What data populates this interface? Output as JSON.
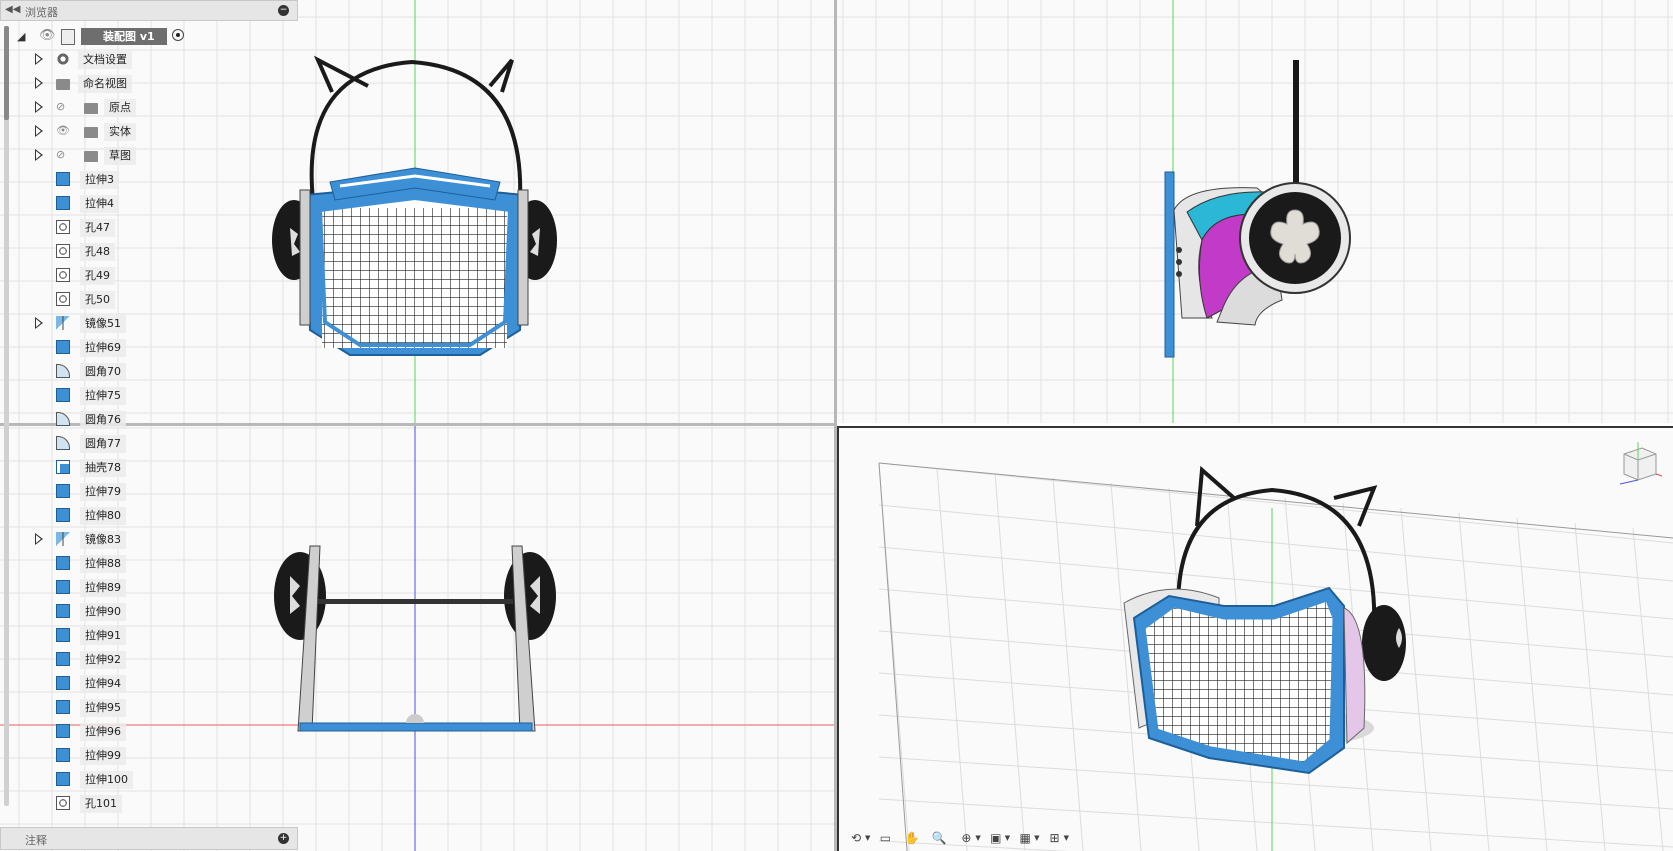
{
  "browser": {
    "title": "浏览器",
    "collapse_icon": "double-left-arrow",
    "root": {
      "label": "装配图 v1"
    },
    "items": [
      {
        "label": "文档设置",
        "icon": "gear-icon",
        "expandable": true,
        "visibility": false
      },
      {
        "label": "命名视图",
        "icon": "folder-icon",
        "expandable": true,
        "visibility": false
      },
      {
        "label": "原点",
        "icon": "folder-icon",
        "expandable": true,
        "visibility": "hidden"
      },
      {
        "label": "实体",
        "icon": "folder-icon",
        "expandable": true,
        "visibility": "visible"
      },
      {
        "label": "草图",
        "icon": "folder-icon",
        "expandable": true,
        "visibility": "hidden"
      },
      {
        "label": "拉伸3",
        "icon": "extrude-icon"
      },
      {
        "label": "拉伸4",
        "icon": "extrude-icon"
      },
      {
        "label": "孔47",
        "icon": "hole-icon"
      },
      {
        "label": "孔48",
        "icon": "hole-icon"
      },
      {
        "label": "孔49",
        "icon": "hole-icon"
      },
      {
        "label": "孔50",
        "icon": "hole-icon"
      },
      {
        "label": "镜像51",
        "icon": "mirror-icon",
        "expandable": true
      },
      {
        "label": "拉伸69",
        "icon": "extrude-icon"
      },
      {
        "label": "圆角70",
        "icon": "fillet-icon"
      },
      {
        "label": "拉伸75",
        "icon": "extrude-icon"
      },
      {
        "label": "圆角76",
        "icon": "fillet-icon"
      },
      {
        "label": "圆角77",
        "icon": "fillet-icon"
      },
      {
        "label": "抽壳78",
        "icon": "shell-icon"
      },
      {
        "label": "拉伸79",
        "icon": "extrude-icon"
      },
      {
        "label": "拉伸80",
        "icon": "extrude-icon"
      },
      {
        "label": "镜像83",
        "icon": "mirror-icon",
        "expandable": true
      },
      {
        "label": "拉伸88",
        "icon": "extrude-icon"
      },
      {
        "label": "拉伸89",
        "icon": "extrude-icon"
      },
      {
        "label": "拉伸90",
        "icon": "extrude-icon"
      },
      {
        "label": "拉伸91",
        "icon": "extrude-icon"
      },
      {
        "label": "拉伸92",
        "icon": "extrude-icon"
      },
      {
        "label": "拉伸94",
        "icon": "extrude-icon"
      },
      {
        "label": "拉伸95",
        "icon": "extrude-icon"
      },
      {
        "label": "拉伸96",
        "icon": "extrude-icon"
      },
      {
        "label": "拉伸99",
        "icon": "extrude-icon"
      },
      {
        "label": "拉伸100",
        "icon": "extrude-icon"
      },
      {
        "label": "孔101",
        "icon": "hole-icon"
      }
    ]
  },
  "annotations": {
    "title": "注释"
  },
  "toolbar": {
    "tools": [
      "orbit-icon",
      "look-at-icon",
      "pan-icon",
      "zoom-icon",
      "fit-icon",
      "display-settings-icon",
      "grid-icon",
      "viewports-icon"
    ]
  },
  "colors": {
    "accent_blue": "#3d8fd6",
    "cyan": "#2bb8d6",
    "magenta": "#c23bc8",
    "axis_green": "#38c038",
    "axis_red": "#e04040",
    "axis_blue": "#4040e0"
  }
}
